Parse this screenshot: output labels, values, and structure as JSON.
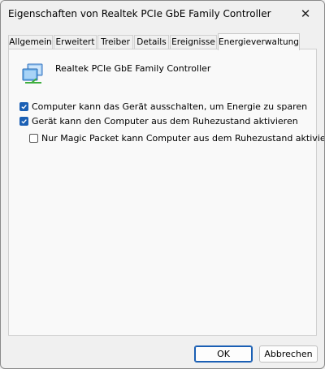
{
  "window": {
    "title": "Eigenschaften von Realtek PCIe GbE Family Controller",
    "close_glyph": "✕"
  },
  "tabs": [
    {
      "label": "Allgemein"
    },
    {
      "label": "Erweitert"
    },
    {
      "label": "Treiber"
    },
    {
      "label": "Details"
    },
    {
      "label": "Ereignisse"
    },
    {
      "label": "Energieverwaltung",
      "active": true
    }
  ],
  "device": {
    "name": "Realtek PCIe GbE Family Controller",
    "icon": "network-adapter-icon"
  },
  "options": [
    {
      "label": "Computer kann das Gerät ausschalten, um Energie zu sparen",
      "checked": true
    },
    {
      "label": "Gerät kann den Computer aus dem Ruhezustand aktivieren",
      "checked": true
    },
    {
      "label": "Nur Magic Packet kann Computer aus dem Ruhezustand aktivieren",
      "checked": false
    }
  ],
  "buttons": {
    "ok": "OK",
    "cancel": "Abbrechen"
  },
  "colors": {
    "accent": "#1a5fb4"
  }
}
